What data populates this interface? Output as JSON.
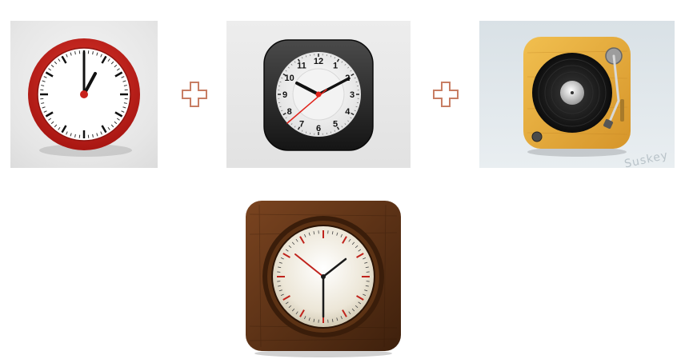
{
  "icons": {
    "red_clock": {
      "name": "red-wall-clock-icon",
      "rim_color": "#c8221c",
      "time": "1:00"
    },
    "ios_clock": {
      "name": "ios-clock-icon",
      "numerals": [
        "12",
        "1",
        "2",
        "3",
        "4",
        "5",
        "6",
        "7",
        "8",
        "9",
        "10",
        "11"
      ],
      "second_hand_color": "#e0231b"
    },
    "turntable": {
      "name": "turntable-icon",
      "wood_color": "#e5a935",
      "watermark": "Suskey"
    },
    "wood_clock": {
      "name": "wooden-clock-icon",
      "wood_color": "#5a3015",
      "accent_color": "#c0231c"
    }
  },
  "operators": [
    {
      "name": "plus-icon",
      "color": "#c87e64"
    },
    {
      "name": "plus-icon",
      "color": "#c87e64"
    }
  ]
}
